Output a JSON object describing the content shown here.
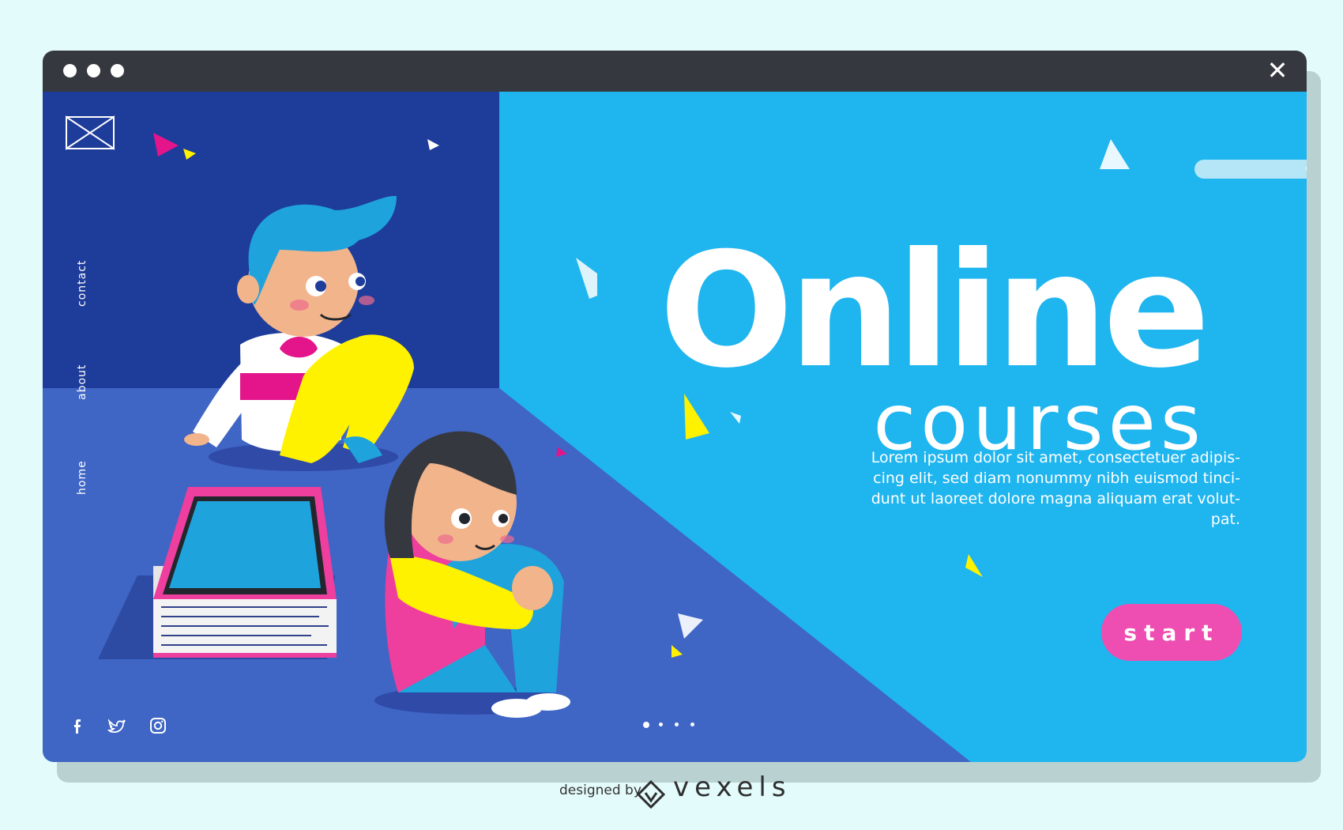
{
  "window": {
    "title_dots": 3,
    "close_icon": "close-icon",
    "bar_color": "#35393f"
  },
  "nav": {
    "logo_icon": "bowtie-logo-icon",
    "items": [
      {
        "label": "contact"
      },
      {
        "label": "about"
      },
      {
        "label": "home"
      }
    ]
  },
  "search": {
    "placeholder": "",
    "icon": "search-icon"
  },
  "hero": {
    "title": "Online",
    "subtitle": "courses",
    "body": "Lorem ipsum dolor sit amet, consectetuer adipis-cing elit, sed diam nonummy nibh euismod tinci-dunt ut laoreet dolore magna aliquam erat volut-pat.",
    "start_label": "start"
  },
  "social": [
    {
      "icon": "facebook-icon"
    },
    {
      "icon": "twitter-icon"
    },
    {
      "icon": "instagram-icon"
    }
  ],
  "pagination": {
    "count": 4,
    "active": 1
  },
  "footer": {
    "credit": "designed by",
    "brand": "vexels",
    "brand_icon": "vexels-logo-icon"
  },
  "colors": {
    "background": "#e4fbfb",
    "left_panel_dark": "#1e3c9a",
    "floor": "#3f65c5",
    "right_panel": "#1fb5ef",
    "accent_pink": "#ee4eb1",
    "accent_yellow": "#fff200"
  }
}
